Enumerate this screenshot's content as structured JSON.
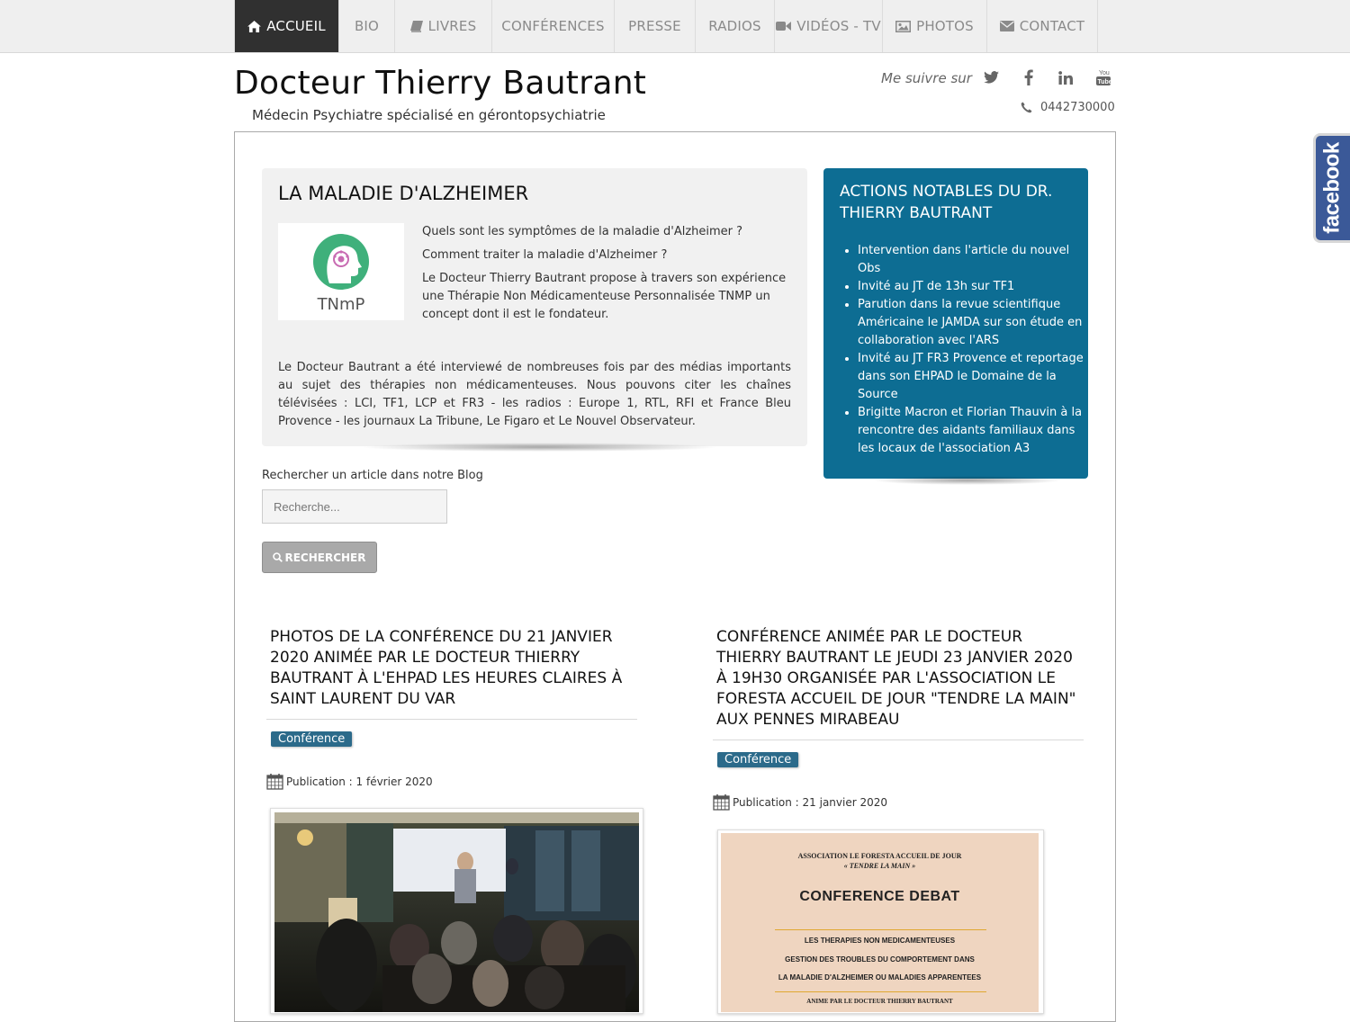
{
  "nav": {
    "items": [
      {
        "label": "ACCUEIL",
        "icon": "home-icon"
      },
      {
        "label": "BIO",
        "icon": ""
      },
      {
        "label": "LIVRES",
        "icon": "book-icon"
      },
      {
        "label": "CONFÉRENCES",
        "icon": ""
      },
      {
        "label": "PRESSE",
        "icon": ""
      },
      {
        "label": "RADIOS",
        "icon": ""
      },
      {
        "label": "VIDÉOS - TV",
        "icon": "video-camera-icon"
      },
      {
        "label": "PHOTOS",
        "icon": "picture-icon"
      },
      {
        "label": "CONTACT",
        "icon": "envelope-icon"
      }
    ],
    "active": "ACCUEIL"
  },
  "header": {
    "title": "Docteur Thierry Bautrant",
    "subtitle": "Médecin Psychiatre spécialisé en gérontopsychiatrie",
    "follow_label": "Me suivre sur",
    "social": [
      "twitter-icon",
      "facebook-icon",
      "linkedin-icon",
      "youtube-icon"
    ],
    "phone": "0442730000"
  },
  "intro": {
    "title": "LA MALADIE D'ALZHEIMER",
    "logo_text": "TNmP",
    "lines": [
      "Quels sont les symptômes de la maladie d'Alzheimer ?",
      "Comment traiter la maladie d'Alzheimer ?",
      "Le Docteur Thierry Bautrant propose à travers son expérience une Thérapie Non Médicamenteuse Personnalisée TNMP un concept dont il est le fondateur."
    ],
    "paragraph": "Le Docteur Bautrant a été interviewé de nombreuses fois par des médias importants au sujet des thérapies non médicamenteuses. Nous pouvons citer les chaînes télévisées : LCI, TF1, LCP et FR3 - les radios : Europe 1, RTL, RFI et France Bleu Provence  - les journaux La Tribune, Le Figaro et Le Nouvel Observateur."
  },
  "actions": {
    "title": "ACTIONS NOTABLES DU DR. THIERRY BAUTRANT",
    "items": [
      "Intervention dans l'article du nouvel Obs",
      "Invité au JT de 13h sur TF1",
      "Parution dans la revue scientifique Américaine le JAMDA sur son étude en collaboration avec l'ARS",
      "Invité au JT FR3 Provence et reportage dans son EHPAD le Domaine de la Source",
      "Brigitte Macron et Florian Thauvin à la rencontre des aidants familiaux dans les locaux de l'association A3"
    ]
  },
  "search": {
    "label": "Rechercher un article dans notre Blog",
    "placeholder": "Recherche...",
    "button": "RECHERCHER"
  },
  "posts": [
    {
      "title": "PHOTOS DE LA CONFÉRENCE DU 21 JANVIER 2020 ANIMÉE PAR LE DOCTEUR THIERRY BAUTRANT À L'EHPAD LES HEURES CLAIRES À SAINT LAURENT DU VAR",
      "category": "Conférence",
      "published": "Publication : 1 février 2020"
    },
    {
      "title": "CONFÉRENCE ANIMÉE PAR LE DOCTEUR THIERRY BAUTRANT LE JEUDI 23 JANVIER 2020 À 19H30 ORGANISÉE PAR L'ASSOCIATION LE FORESTA ACCUEIL DE JOUR \"TENDRE LA MAIN\" AUX PENNES MIRABEAU",
      "category": "Conférence",
      "published": "Publication : 21 janvier 2020"
    }
  ],
  "poster": {
    "line1": "ASSOCIATION LE FORESTA  ACCUEIL DE JOUR",
    "line2": "« TENDRE LA MAIN »",
    "headline": "CONFERENCE DEBAT",
    "sub1": "LES THERAPIES NON MEDICAMENTEUSES",
    "sub2": "GESTION DES TROUBLES DU COMPORTEMENT DANS",
    "sub3": "LA MALADIE D'ALZHEIMER OU MALADIES APPARENTEES",
    "sub4": "ANIME PAR LE DOCTEUR THIERRY BAUTRANT"
  },
  "facebook_tab": "facebook",
  "colors": {
    "nav_active_bg": "#303030",
    "panel_blue": "#0d6d93",
    "badge": "#2b6a8a",
    "facebook": "#3b5998"
  }
}
